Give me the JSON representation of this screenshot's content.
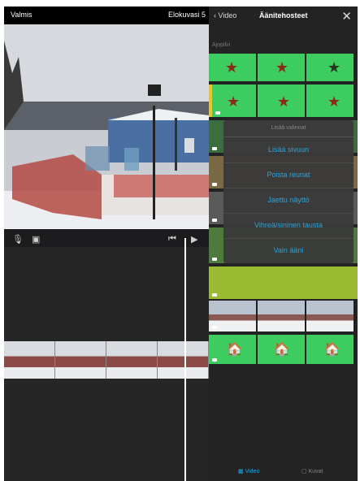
{
  "editor": {
    "back_label": "Valmis",
    "project_label": "Elokuvasi 5"
  },
  "panel": {
    "back_label": "Video",
    "title": "Äänitehosteet",
    "section_label": "Ajopilvi",
    "menu": {
      "header": "Lisää valinnat",
      "items": [
        "Lisää sivuun",
        "Poista reunat",
        "Jaettu näyttö",
        "Vihreä/sininen tausta",
        "Vain ääni"
      ]
    },
    "bottom": {
      "tab1": "Video",
      "tab2": "Kuvat"
    }
  },
  "colors": {
    "accent": "#29a8e0",
    "green": "#3ccc5f"
  }
}
